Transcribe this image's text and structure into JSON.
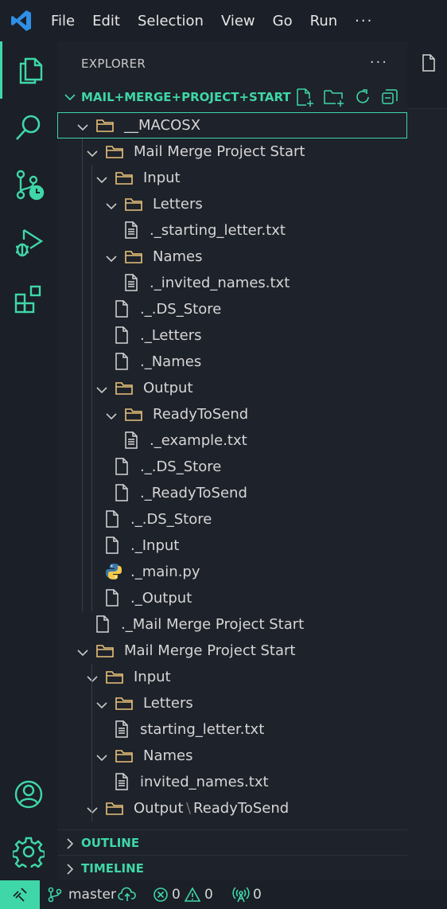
{
  "menu": {
    "items": [
      "File",
      "Edit",
      "Selection",
      "View",
      "Go",
      "Run"
    ],
    "more": "···"
  },
  "explorer": {
    "title": "EXPLORER",
    "more": "···",
    "folder": "MAIL+MERGE+PROJECT+START"
  },
  "tree": [
    {
      "label": "__MACOSX",
      "type": "folder",
      "depth": 0,
      "open": true,
      "selected": true
    },
    {
      "label": "Mail Merge Project Start",
      "type": "folder",
      "depth": 1,
      "open": true
    },
    {
      "label": "Input",
      "type": "folder",
      "depth": 2,
      "open": true
    },
    {
      "label": "Letters",
      "type": "folder",
      "depth": 3,
      "open": true
    },
    {
      "label": "._starting_letter.txt",
      "type": "text",
      "depth": 4
    },
    {
      "label": "Names",
      "type": "folder",
      "depth": 3,
      "open": true
    },
    {
      "label": "._invited_names.txt",
      "type": "text",
      "depth": 4
    },
    {
      "label": "._.DS_Store",
      "type": "file",
      "depth": 3
    },
    {
      "label": "._Letters",
      "type": "file",
      "depth": 3
    },
    {
      "label": "._Names",
      "type": "file",
      "depth": 3
    },
    {
      "label": "Output",
      "type": "folder",
      "depth": 2,
      "open": true
    },
    {
      "label": "ReadyToSend",
      "type": "folder",
      "depth": 3,
      "open": true
    },
    {
      "label": "._example.txt",
      "type": "text",
      "depth": 4
    },
    {
      "label": "._.DS_Store",
      "type": "file",
      "depth": 3
    },
    {
      "label": "._ReadyToSend",
      "type": "file",
      "depth": 3
    },
    {
      "label": "._.DS_Store",
      "type": "file",
      "depth": 2
    },
    {
      "label": "._Input",
      "type": "file",
      "depth": 2
    },
    {
      "label": "._main.py",
      "type": "python",
      "depth": 2
    },
    {
      "label": "._Output",
      "type": "file",
      "depth": 2
    },
    {
      "label": "._Mail Merge Project Start",
      "type": "file",
      "depth": 1
    },
    {
      "label": "Mail Merge Project Start",
      "type": "folder",
      "depth": 0,
      "open": true
    },
    {
      "label": "Input",
      "type": "folder",
      "depth": 1,
      "open": true
    },
    {
      "label": "Letters",
      "type": "folder",
      "depth": 2,
      "open": true
    },
    {
      "label": "starting_letter.txt",
      "type": "text",
      "depth": 3
    },
    {
      "label": "Names",
      "type": "folder",
      "depth": 2,
      "open": true
    },
    {
      "label": "invited_names.txt",
      "type": "text",
      "depth": 3
    },
    {
      "label": "Output",
      "label2": "ReadyToSend",
      "type": "folder",
      "depth": 1,
      "open": true
    }
  ],
  "panels": {
    "outline": "OUTLINE",
    "timeline": "TIMELINE"
  },
  "status": {
    "branch": "master",
    "errors": "0",
    "warnings": "0",
    "ports": "0"
  },
  "colors": {
    "accent": "#3fd7a8",
    "folder": "#e8c27a",
    "bg": "#1e222a"
  }
}
